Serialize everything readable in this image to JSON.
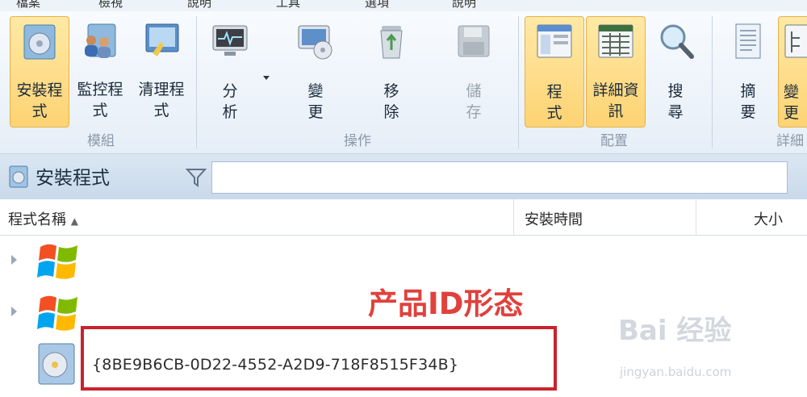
{
  "menu": [
    "檔案",
    "檢視",
    "說明",
    "工具",
    "選項",
    "說明"
  ],
  "ribbon": {
    "groups": [
      {
        "label": "模組",
        "buttons": [
          {
            "label": "安裝程式",
            "icon": "installer-disc-icon",
            "active": true
          },
          {
            "label": "監控程式",
            "icon": "monitor-users-icon",
            "active": false
          },
          {
            "label": "清理程式",
            "icon": "cleanup-icon",
            "active": false
          }
        ]
      },
      {
        "label": "操作",
        "buttons": [
          {
            "label": "分析",
            "icon": "analyze-monitor-icon",
            "active": false
          },
          {
            "label": "變更",
            "icon": "change-disc-icon",
            "active": false
          },
          {
            "label": "移除",
            "icon": "recycle-bin-icon",
            "active": false
          },
          {
            "label": "儲存",
            "icon": "floppy-save-icon",
            "active": false,
            "disabled": true
          }
        ]
      },
      {
        "label": "配置",
        "buttons": [
          {
            "label": "程式",
            "icon": "program-window-icon",
            "active": true
          },
          {
            "label": "詳細資訊",
            "icon": "details-grid-icon",
            "active": true
          },
          {
            "label": "搜尋",
            "icon": "magnifier-icon",
            "active": false
          }
        ]
      },
      {
        "label": "詳細",
        "buttons": [
          {
            "label": "摘要",
            "icon": "summary-doc-icon",
            "active": false
          },
          {
            "label": "變更",
            "icon": "tree-icon",
            "active": true
          }
        ]
      }
    ]
  },
  "titlebar": {
    "title": "安裝程式"
  },
  "columns": {
    "name": "程式名稱",
    "sort": "▲",
    "install_time": "安裝時間",
    "size": "大小"
  },
  "rows": {
    "product_id": "{8BE9B6CB-0D22-4552-A2D9-718F8515F34B}"
  },
  "annotation": {
    "label": "产品ID形态"
  },
  "watermark": {
    "brand": "Bai 经验",
    "url": "jingyan.baidu.com"
  },
  "colors": {
    "accent": "#fdd373",
    "annotation": "#c8232c"
  }
}
